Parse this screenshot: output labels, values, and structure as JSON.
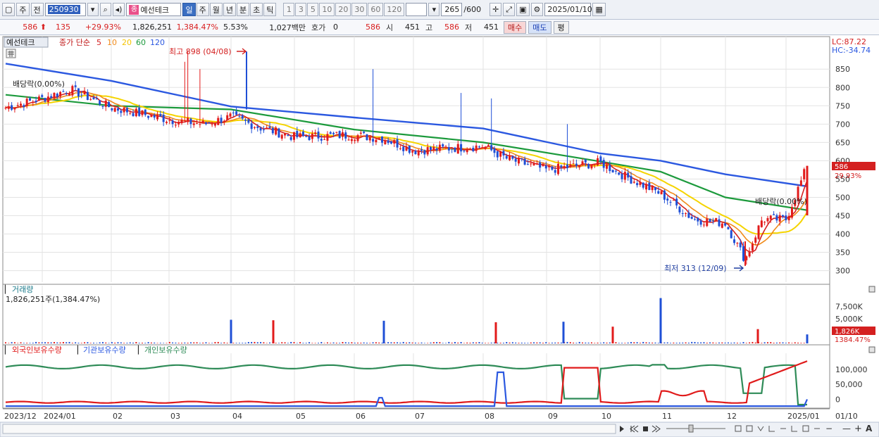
{
  "toolbar": {
    "mode_label": "주",
    "compare_label": "전",
    "stock_code": "250930",
    "stock_name": "예선테크",
    "period_buttons": [
      "일",
      "주",
      "월",
      "년",
      "분",
      "초",
      "틱"
    ],
    "active_period": "일",
    "interval_buttons": [
      "1",
      "3",
      "5",
      "10",
      "20",
      "30",
      "60",
      "120"
    ],
    "count_value": "265",
    "count_max": "/600",
    "date_value": "2025/01/10"
  },
  "quote": {
    "price": "586",
    "change": "135",
    "change_pct": "+29.93%",
    "volume": "1,826,251",
    "volume_pct": "1,384.47%",
    "turnover": "5.53%",
    "amount": "1,027백만",
    "bid_label": "호가",
    "bid_value": "0",
    "bid_price": "586",
    "open_label": "시",
    "open_value": "451",
    "high_label": "고",
    "high_value": "586",
    "low_label": "저",
    "low_value": "451",
    "buy_label": "매수",
    "sell_label": "매도",
    "eval_label": "평"
  },
  "price_panel": {
    "title": "예선테크",
    "ma_label": "종가 단순",
    "ma_periods": [
      "5",
      "10",
      "20",
      "60",
      "120"
    ],
    "lc_label": "LC:87.22",
    "hc_label": "HC:-34.74",
    "high_annotation": "최고 898 (04/08)",
    "low_annotation": "최저 313 (12/09)",
    "dividend_left": "배당락(0.00%)",
    "dividend_right": "배당락(0.00%)",
    "current_price_tag": "586",
    "current_pct_tag": "29.93%"
  },
  "volume_panel": {
    "title": "거래량",
    "value_label": "1,826,251주(1,384.47%)",
    "tag_value": "1,826K",
    "tag_pct": "1384.47%"
  },
  "holdings_panel": {
    "legend": [
      "외국인보유수량",
      "기관보유수량",
      "개인보유수량"
    ]
  },
  "colors": {
    "up": "#e21b1b",
    "down": "#1f4fd6",
    "ma5": "#d42020",
    "ma10": "#f08a1a",
    "ma20": "#f5d400",
    "ma60": "#1c9a3c",
    "ma120": "#2b58e0",
    "foreign": "#e01b1b",
    "institution": "#2b58e0",
    "individual": "#2e8b57"
  },
  "chart_data": [
    {
      "type": "candlestick",
      "title": "예선테크",
      "x_labels": [
        "2023/12",
        "2024/01",
        "02",
        "03",
        "04",
        "05",
        "06",
        "07",
        "08",
        "09",
        "10",
        "11",
        "12",
        "2025/01",
        "01/10"
      ],
      "y_ticks": [
        300,
        350,
        400,
        450,
        500,
        550,
        600,
        650,
        700,
        750,
        800,
        850
      ],
      "ylim": [
        280,
        885
      ],
      "high": {
        "value": 898,
        "date": "04/08"
      },
      "low": {
        "value": 313,
        "date": "12/09"
      },
      "last": {
        "open": 451,
        "high": 586,
        "low": 451,
        "close": 586,
        "change_pct": 29.93
      },
      "close_path": [
        {
          "m": "2023/12",
          "v": 745
        },
        {
          "m": "2024/01",
          "v": 770
        },
        {
          "m": "01m",
          "v": 795
        },
        {
          "m": "02",
          "v": 745
        },
        {
          "m": "03",
          "v": 712
        },
        {
          "m": "03m",
          "v": 700
        },
        {
          "m": "04",
          "v": 720
        },
        {
          "m": "04m",
          "v": 690
        },
        {
          "m": "05",
          "v": 665
        },
        {
          "m": "06",
          "v": 670
        },
        {
          "m": "06m",
          "v": 660
        },
        {
          "m": "07",
          "v": 628
        },
        {
          "m": "08",
          "v": 640
        },
        {
          "m": "08m",
          "v": 605
        },
        {
          "m": "09",
          "v": 575
        },
        {
          "m": "10",
          "v": 595
        },
        {
          "m": "10m",
          "v": 560
        },
        {
          "m": "11",
          "v": 510
        },
        {
          "m": "11m",
          "v": 440
        },
        {
          "m": "12",
          "v": 430
        },
        {
          "m": "12m",
          "v": 330
        },
        {
          "m": "12e",
          "v": 440
        },
        {
          "m": "2025/01",
          "v": 440
        },
        {
          "m": "01/10",
          "v": 586
        }
      ],
      "ma120": [
        {
          "m": "2023/12",
          "v": 865
        },
        {
          "m": "02",
          "v": 818
        },
        {
          "m": "04",
          "v": 748
        },
        {
          "m": "06",
          "v": 718
        },
        {
          "m": "08",
          "v": 688
        },
        {
          "m": "10",
          "v": 620
        },
        {
          "m": "11",
          "v": 600
        },
        {
          "m": "12",
          "v": 563
        },
        {
          "m": "01/10",
          "v": 530
        }
      ],
      "ma60": [
        {
          "m": "2023/12",
          "v": 780
        },
        {
          "m": "02",
          "v": 750
        },
        {
          "m": "04",
          "v": 740
        },
        {
          "m": "06",
          "v": 685
        },
        {
          "m": "08",
          "v": 650
        },
        {
          "m": "10",
          "v": 598
        },
        {
          "m": "11",
          "v": 570
        },
        {
          "m": "12",
          "v": 500
        },
        {
          "m": "01/10",
          "v": 465
        }
      ]
    },
    {
      "type": "bar",
      "title": "거래량",
      "y_ticks": [
        "5,000K",
        "7,500K"
      ],
      "spikes": [
        {
          "m": "04",
          "v": 4800
        },
        {
          "m": "04m",
          "v": 4700
        },
        {
          "m": "06m",
          "v": 4600
        },
        {
          "m": "08",
          "v": 4300
        },
        {
          "m": "09m",
          "v": 4400
        },
        {
          "m": "10",
          "v": 3400
        },
        {
          "m": "11",
          "v": 9200
        },
        {
          "m": "12m",
          "v": 2900
        },
        {
          "m": "01/10",
          "v": 1826
        }
      ]
    },
    {
      "type": "line",
      "title": "외국인보유수량 / 기관보유수량 / 개인보유수량",
      "y_ticks": [
        "0",
        "50,000",
        "100,000"
      ],
      "series": [
        {
          "name": "외국인보유수량"
        },
        {
          "name": "기관보유수량"
        },
        {
          "name": "개인보유수량"
        }
      ]
    }
  ]
}
